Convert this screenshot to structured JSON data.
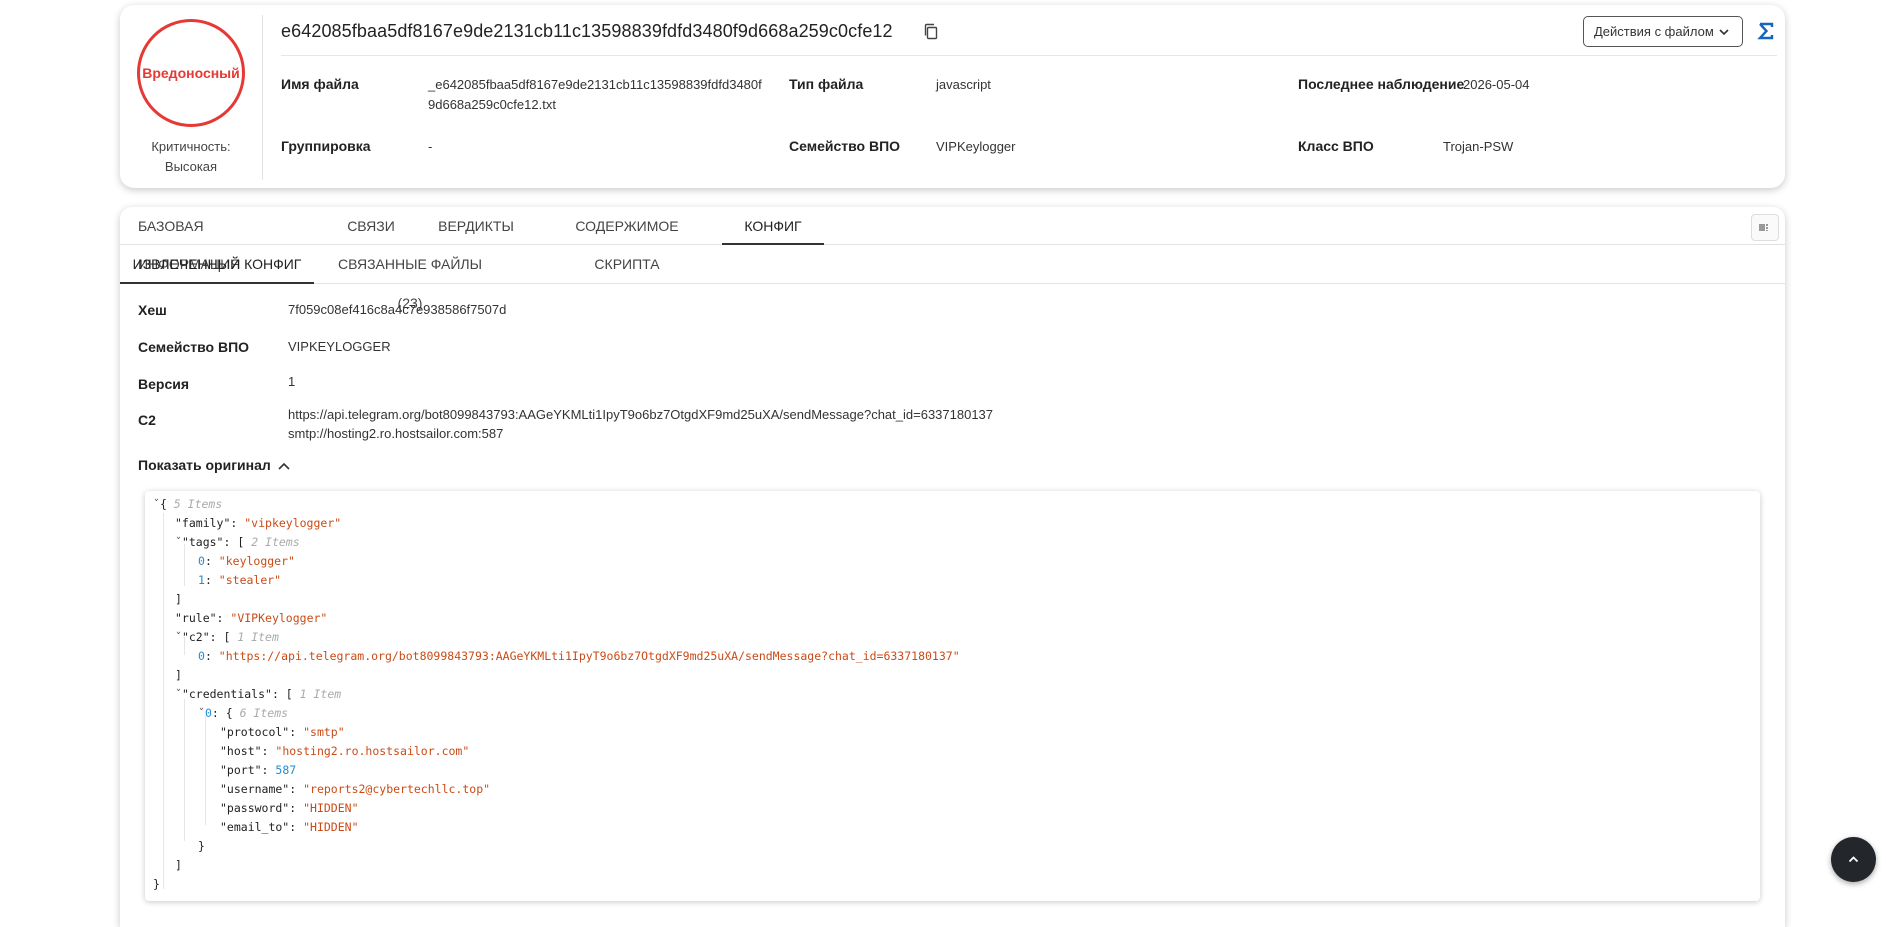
{
  "header": {
    "verdict": "Вредоносный",
    "severity_label": "Критичность:",
    "severity_value": "Высокая",
    "hash": "e642085fbaa5df8167e9de2131cb11c13598839fdfd3480f9d668a259c0cfe12",
    "actions_label": "Действия с файлом",
    "accent_color": "#1565c0",
    "verdict_color": "#e53935",
    "fields": {
      "file_name_label": "Имя файла",
      "file_name_line1": "_e642085fbaa5df8167e9de2131cb11c13598839fdfd3480f",
      "file_name_line2": "9d668a259c0cfe12.txt",
      "file_type_label": "Тип файла",
      "file_type_value": "javascript",
      "last_seen_label": "Последнее наблюдение",
      "last_seen_value": "2026-05-04",
      "group_label": "Группировка",
      "group_value": "-",
      "family_label": "Семейство ВПО",
      "family_value": "VIPKeylogger",
      "class_label": "Класс ВПО",
      "class_value": "Trojan-PSW"
    }
  },
  "tabs": [
    {
      "label": "БАЗОВАЯ ИНФОРМАЦИЯ"
    },
    {
      "label": "СВЯЗИ"
    },
    {
      "label": "ВЕРДИКТЫ"
    },
    {
      "label": "СОДЕРЖИМОЕ СКРИПТА"
    },
    {
      "label": "КОНФИГ"
    }
  ],
  "subtabs": [
    {
      "label": "ИЗВЛЕЧЕННЫЙ КОНФИГ"
    },
    {
      "label": "СВЯЗАННЫЕ ФАЙЛЫ (23)"
    }
  ],
  "config": {
    "hash_label": "Хеш",
    "hash_value": "7f059c08ef416c8a4c7e938586f7507d",
    "family_label": "Семейство ВПО",
    "family_value": "VIPKEYLOGGER",
    "version_label": "Версия",
    "version_value": "1",
    "c2_label": "C2",
    "c2_line1": "https://api.telegram.org/bot8099843793:AAGeYKMLti1IpyT9o6bz7OtgdXF9md25uXA/sendMessage?chat_id=6337180137",
    "c2_line2": "smtp://hosting2.ro.hostsailor.com:587",
    "show_original_label": "Показать оригинал"
  },
  "json_view": {
    "root_meta": "5 Items",
    "family_key": "\"family\"",
    "family_val": "\"vipkeylogger\"",
    "tags_key": "\"tags\"",
    "tags_meta": "2 Items",
    "tag0_idx": "0",
    "tag0": "\"keylogger\"",
    "tag1_idx": "1",
    "tag1": "\"stealer\"",
    "rule_key": "\"rule\"",
    "rule_val": "\"VIPKeylogger\"",
    "c2_key": "\"c2\"",
    "c2_meta": "1 Item",
    "c2_0_idx": "0",
    "c2_0": "\"https://api.telegram.org/bot8099843793:AAGeYKMLti1IpyT9o6bz7OtgdXF9md25uXA/sendMessage?chat_id=6337180137\"",
    "cred_key": "\"credentials\"",
    "cred_meta": "1 Item",
    "cred0_idx": "0",
    "cred0_meta": "6 Items",
    "protocol_key": "\"protocol\"",
    "protocol_val": "\"smtp\"",
    "host_key": "\"host\"",
    "host_val": "\"hosting2.ro.hostsailor.com\"",
    "port_key": "\"port\"",
    "port_val": "587",
    "username_key": "\"username\"",
    "username_val": "\"reports2@cybertechllc.top\"",
    "password_key": "\"password\"",
    "password_val": "\"HIDDEN\"",
    "email_to_key": "\"email_to\"",
    "email_to_val": "\"HIDDEN\""
  }
}
